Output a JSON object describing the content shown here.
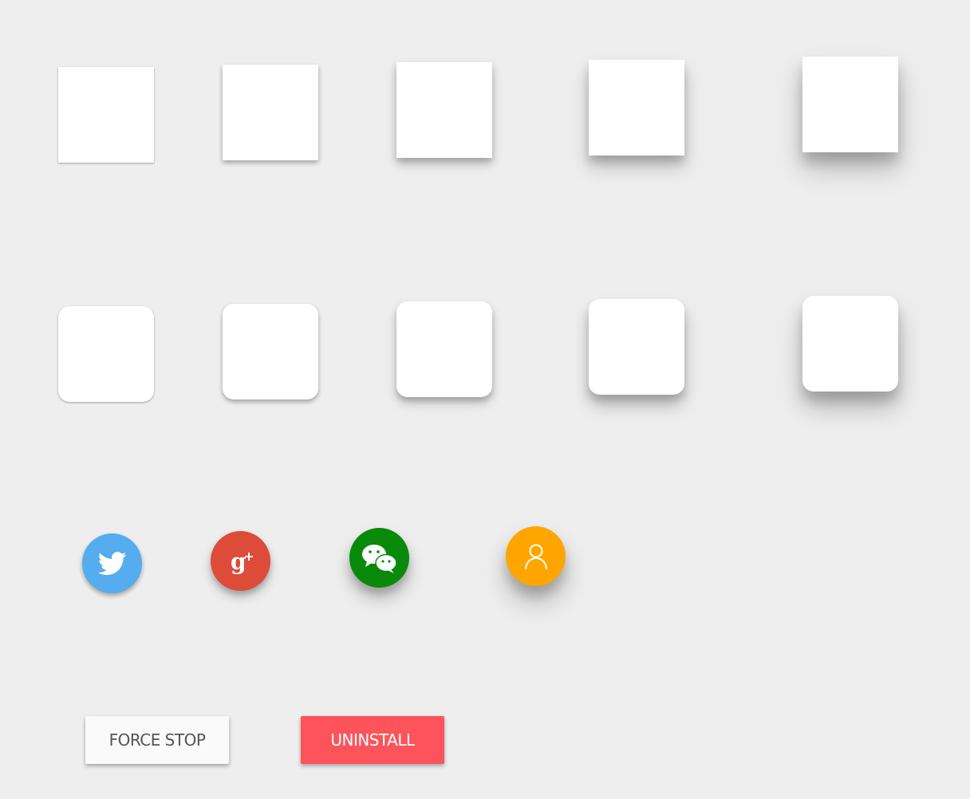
{
  "cards_square": [
    {
      "elevation": 1
    },
    {
      "elevation": 2
    },
    {
      "elevation": 3
    },
    {
      "elevation": 4
    },
    {
      "elevation": 5
    }
  ],
  "cards_rounded": [
    {
      "elevation": 1
    },
    {
      "elevation": 2
    },
    {
      "elevation": 3
    },
    {
      "elevation": 4
    },
    {
      "elevation": 5
    }
  ],
  "fabs": [
    {
      "icon": "twitter-icon",
      "color": "#55acee"
    },
    {
      "icon": "google-plus-icon",
      "color": "#dd4b39"
    },
    {
      "icon": "wechat-icon",
      "color": "#0a8a0a"
    },
    {
      "icon": "user-icon",
      "color": "#ffa500"
    }
  ],
  "buttons": {
    "force_stop": "FORCE STOP",
    "uninstall": "UNINSTALL"
  },
  "colors": {
    "background": "#eeeeee",
    "card": "#ffffff",
    "force_stop_bg": "#fafafa",
    "force_stop_text": "#555555",
    "uninstall_bg": "#fd535a",
    "uninstall_text": "#ffffff"
  }
}
